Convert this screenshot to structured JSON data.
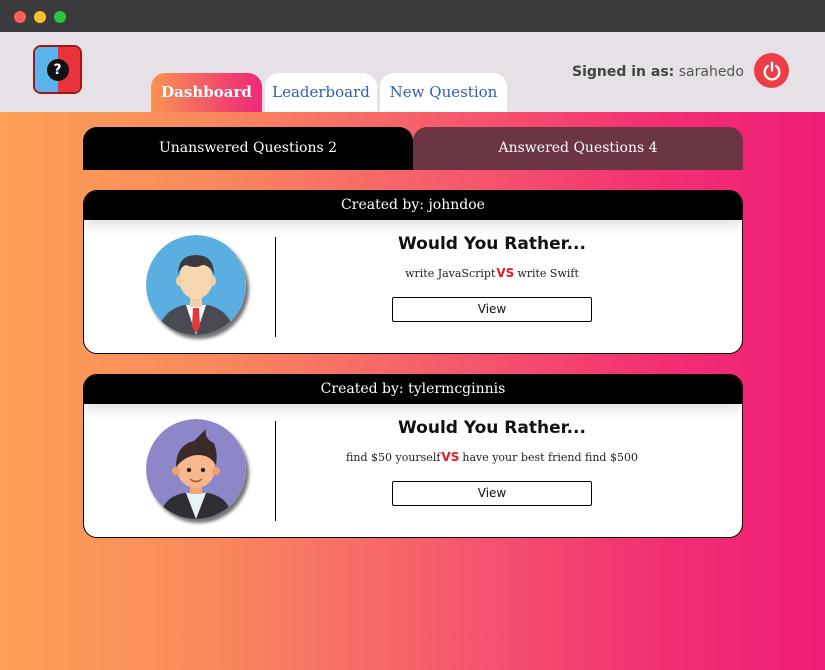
{
  "header": {
    "tabs": [
      {
        "label": "Dashboard",
        "active": true
      },
      {
        "label": "Leaderboard",
        "active": false
      },
      {
        "label": "New Question",
        "active": false
      }
    ],
    "signed_in_label": "Signed in as:",
    "signed_in_user": "sarahedo",
    "icons": {
      "logo": "would-you-rather-logo",
      "logout": "power-icon"
    }
  },
  "question_tabs": [
    {
      "label": "Unanswered Questions 2",
      "active": true
    },
    {
      "label": "Answered Questions 4",
      "active": false
    }
  ],
  "questions": [
    {
      "created_by": "Created by: johndoe",
      "title": "Would You Rather...",
      "option_one": "write JavaScript",
      "vs": "VS",
      "option_two": "write Swift",
      "button": "View",
      "avatar": "businessman-avatar-icon"
    },
    {
      "created_by": "Created by: tylermcginnis",
      "title": "Would You Rather...",
      "option_one": "find $50 yourself",
      "vs": "VS",
      "option_two": "have your best friend find $500",
      "button": "View",
      "avatar": "young-man-avatar-icon"
    }
  ],
  "colors": {
    "accent_red": "#e11c24",
    "power": "#ec3e47",
    "tab_link": "#2f5fb0"
  }
}
